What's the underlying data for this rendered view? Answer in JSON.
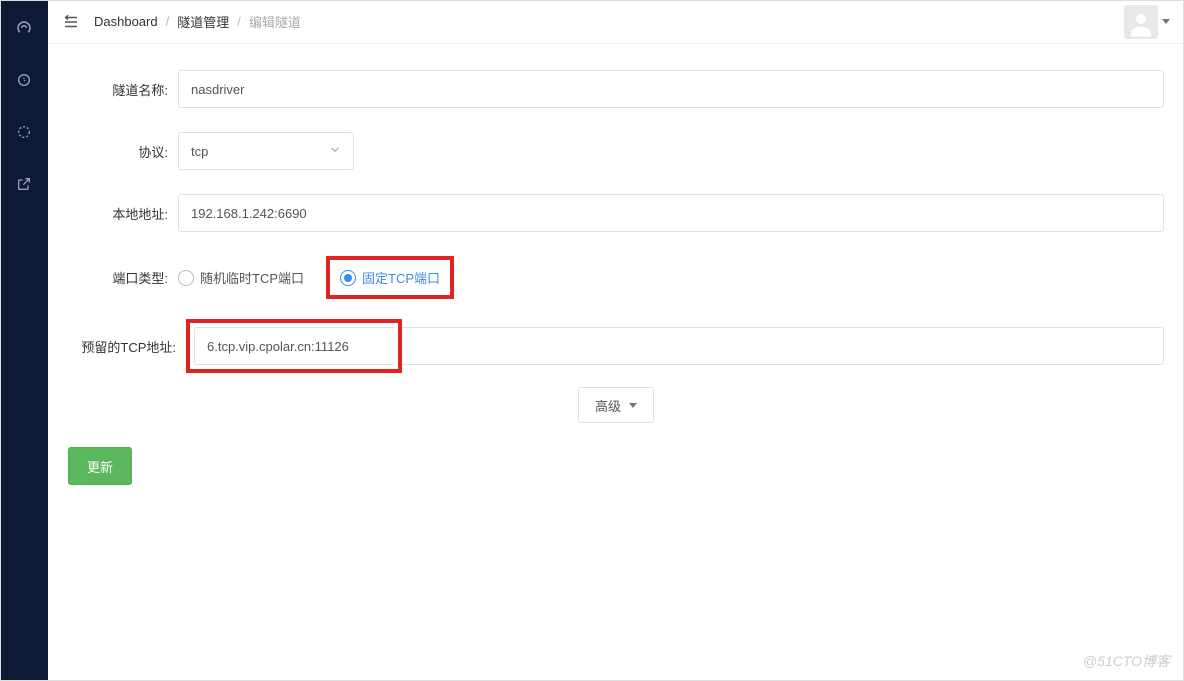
{
  "breadcrumb": {
    "root": "Dashboard",
    "mid": "隧道管理",
    "current": "编辑隧道"
  },
  "form": {
    "name_label": "隧道名称:",
    "name_value": "nasdriver",
    "protocol_label": "协议:",
    "protocol_value": "tcp",
    "local_label": "本地地址:",
    "local_value": "192.168.1.242:6690",
    "port_type_label": "端口类型:",
    "port_type_options": {
      "random": "随机临时TCP端口",
      "fixed": "固定TCP端口"
    },
    "port_type_selected": "fixed",
    "reserved_label": "预留的TCP地址:",
    "reserved_value": "6.tcp.vip.cpolar.cn:11126",
    "advanced_label": "高级",
    "update_label": "更新"
  },
  "watermark": "@51CTO博客"
}
